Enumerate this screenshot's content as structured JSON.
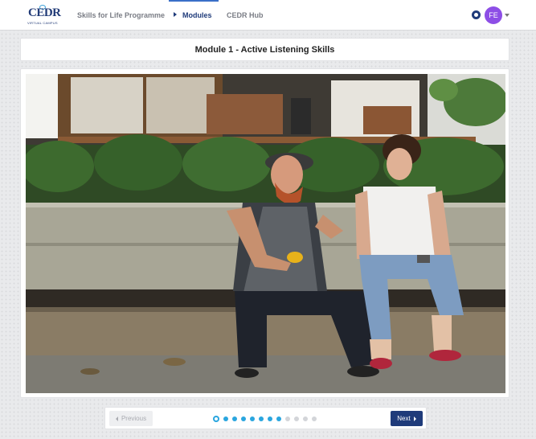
{
  "nav": {
    "logo_text": "CEDR",
    "logo_sub": "VIRTUAL CAMPUS",
    "links": [
      "Skills for Life Programme",
      "Modules",
      "CEDR Hub"
    ],
    "active_link": "Modules",
    "avatar_initials": "FE",
    "colors": {
      "brand": "#1f3b7a",
      "avatar": "#8d4ee6",
      "active_bar": "#3a6fc8"
    }
  },
  "module": {
    "title": "Module 1 - Active Listening Skills",
    "image_alt": "Two people sitting on a bench outside a cafe, talking"
  },
  "pager": {
    "prev_label": "Previous",
    "next_label": "Next",
    "total_pages": 12,
    "current_page": 1,
    "completed_pages": 8,
    "colors": {
      "dot_active": "#2aa6df",
      "dot_inactive": "#d3d5d9"
    }
  }
}
